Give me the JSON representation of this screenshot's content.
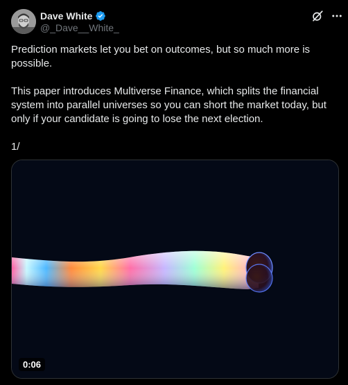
{
  "author": {
    "display_name": "Dave White",
    "handle": "@_Dave__White_",
    "verified": true,
    "verified_color": "#1d9bf0"
  },
  "header_icons": [
    "grok-icon",
    "more-options-icon"
  ],
  "tweet": {
    "paragraph_1": "Prediction markets let you bet on outcomes, but so much more is possible.",
    "paragraph_2": "This paper introduces Multiverse Finance, which splits the financial system into parallel universes so you can short the market today, but only if your candidate is going to lose the next election.",
    "paragraph_3": "1/"
  },
  "media": {
    "type": "video",
    "duration": "0:06"
  },
  "colors": {
    "background": "#000000",
    "text": "#e7e9ea",
    "muted": "#71767b",
    "video_background": "#040916"
  }
}
